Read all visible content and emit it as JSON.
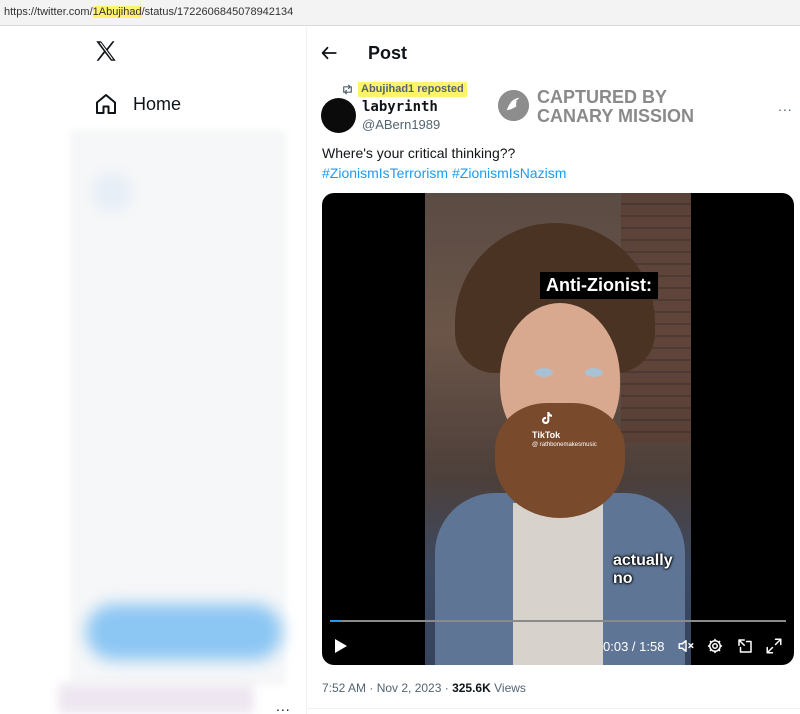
{
  "browser": {
    "url_prefix": "https://twitter.com/",
    "url_user": "1Abujihad",
    "url_suffix": "/status/1722606845078942134"
  },
  "sidebar": {
    "home_label": "Home",
    "more_label": "..."
  },
  "header": {
    "title": "Post"
  },
  "tweet": {
    "reposted_by": "Abujihad1 reposted",
    "author_name": "labyrinth",
    "author_handle": "@ABern1989",
    "text": "Where's your critical thinking??",
    "hashtags": [
      "#ZionismIsTerrorism",
      "#ZionismIsNazism"
    ],
    "more_label": "...",
    "timestamp": "7:52 AM · Nov 2, 2023 · ",
    "views_count": "325.6K",
    "views_label": " Views"
  },
  "watermark": {
    "line1": "CAPTURED BY",
    "line2": "CANARY MISSION"
  },
  "video": {
    "caption_top": "Anti-Zionist:",
    "tiktok_label": "TikTok",
    "tiktok_user": "@ rathbonemakesmusic",
    "caption_bottom": "actually no",
    "time_display": "0:03 / 1:58",
    "progress_fraction": 0.025
  },
  "icons": {
    "logo": "x-logo-icon",
    "home": "home-icon",
    "back": "arrow-left-icon",
    "repost": "repost-icon",
    "play": "play-icon",
    "mute": "volume-muted-icon",
    "settings": "gear-icon",
    "pip": "picture-in-picture-icon",
    "fullscreen": "fullscreen-icon"
  },
  "colors": {
    "accent": "#1d9bf0",
    "highlight": "#fff36b",
    "text_primary": "#0f1419",
    "text_secondary": "#536471"
  }
}
